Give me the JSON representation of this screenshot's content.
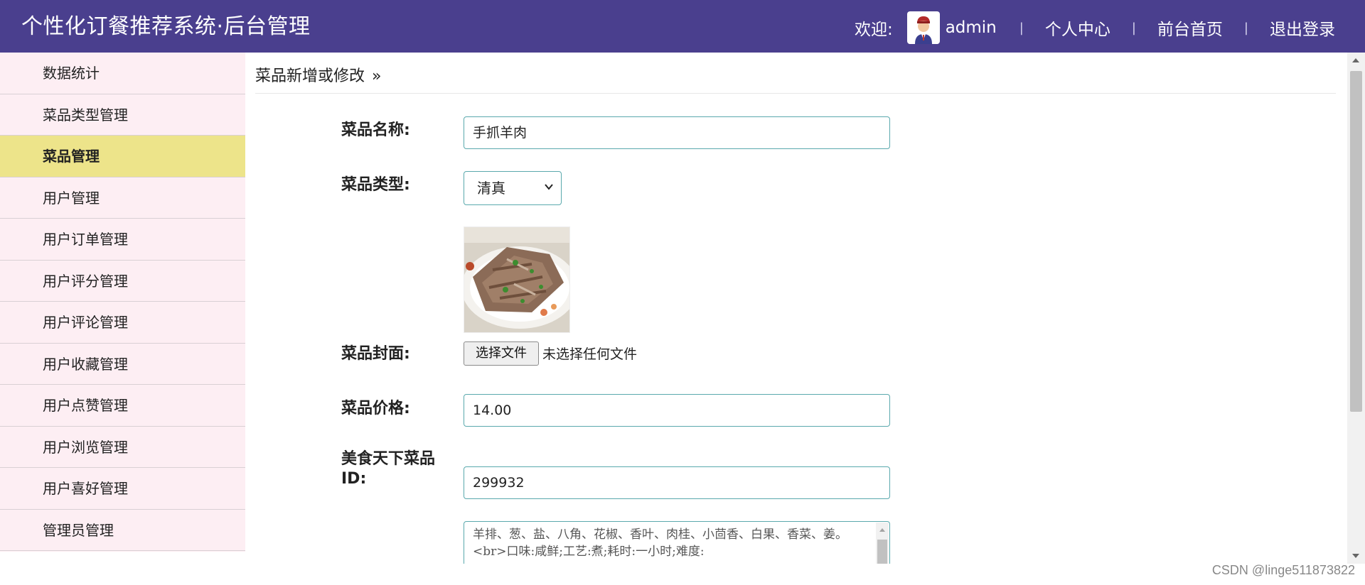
{
  "header": {
    "title": "个性化订餐推荐系统·后台管理",
    "welcome": "欢迎:",
    "username": "admin",
    "links": [
      "个人中心",
      "前台首页",
      "退出登录"
    ],
    "separator": "|"
  },
  "sidebar": {
    "items": [
      {
        "label": "数据统计",
        "active": false
      },
      {
        "label": "菜品类型管理",
        "active": false
      },
      {
        "label": "菜品管理",
        "active": true
      },
      {
        "label": "用户管理",
        "active": false
      },
      {
        "label": "用户订单管理",
        "active": false
      },
      {
        "label": "用户评分管理",
        "active": false
      },
      {
        "label": "用户评论管理",
        "active": false
      },
      {
        "label": "用户收藏管理",
        "active": false
      },
      {
        "label": "用户点赞管理",
        "active": false
      },
      {
        "label": "用户浏览管理",
        "active": false
      },
      {
        "label": "用户喜好管理",
        "active": false
      },
      {
        "label": "管理员管理",
        "active": false
      }
    ]
  },
  "breadcrumb": {
    "text": "菜品新增或修改",
    "arrow": "»"
  },
  "form": {
    "name_label": "菜品名称:",
    "name_value": "手抓羊肉",
    "type_label": "菜品类型:",
    "type_value": "清真",
    "cover_label": "菜品封面:",
    "file_button": "选择文件",
    "file_status": "未选择任何文件",
    "price_label": "菜品价格:",
    "price_value": "14.00",
    "ext_id_label_line1": "美食天下菜品",
    "ext_id_label_line2": "ID:",
    "ext_id_value": "299932",
    "desc_value": "羊排、葱、盐、八角、花椒、香叶、肉桂、小茴香、白果、香菜、姜。<br>口味:咸鲜;工艺:煮;耗时:一小时;难度:"
  },
  "watermark": "CSDN @linge511873822",
  "colors": {
    "header_bg": "#4a3f8e",
    "sidebar_bg": "#fdeef3",
    "sidebar_active": "#ede48a",
    "input_border": "#5aa9ad"
  }
}
